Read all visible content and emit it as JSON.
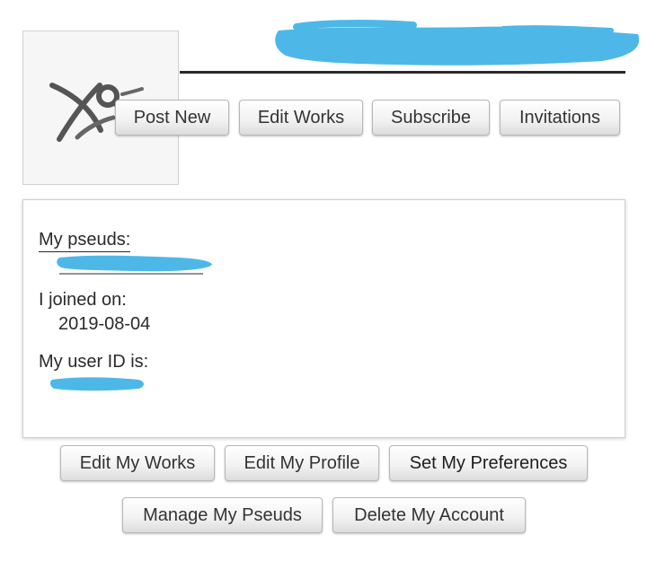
{
  "header": {
    "username": ""
  },
  "actions": {
    "post_new": "Post New",
    "edit_works": "Edit Works",
    "subscribe": "Subscribe",
    "invitations": "Invitations"
  },
  "profile": {
    "pseuds_label": "My pseuds:",
    "pseud_value": "",
    "joined_label": "I joined on:",
    "joined_value": "2019-08-04",
    "user_id_label": "My user ID is:",
    "user_id_value": ""
  },
  "bottom_actions": {
    "edit_my_works": "Edit My Works",
    "edit_my_profile": "Edit My Profile",
    "set_my_preferences": "Set My Preferences",
    "manage_my_pseuds": "Manage My Pseuds",
    "delete_my_account": "Delete My Account"
  },
  "colors": {
    "redaction": "#4db8e8",
    "text": "#2a2a2a",
    "button_border": "#b8b8b8"
  },
  "icons": {
    "avatar": "default-avatar-icon"
  }
}
